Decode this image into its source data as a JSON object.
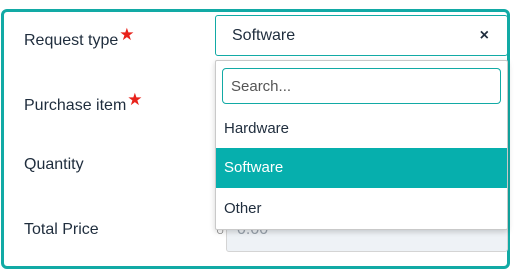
{
  "form": {
    "request_type_label": "Request type",
    "purchase_item_label": "Purchase item",
    "quantity_label": "Quantity",
    "total_price_label": "Total Price",
    "required_marker": "★",
    "total_price_value": "0.00"
  },
  "select": {
    "value": "Software",
    "clear_icon": "×",
    "search_placeholder": "Search...",
    "options": [
      "Hardware",
      "Software",
      "Other"
    ],
    "selected_index": 1
  },
  "colors": {
    "accent": "#12aaa5",
    "selected_bg": "#06afad",
    "required": "#e8221b"
  }
}
